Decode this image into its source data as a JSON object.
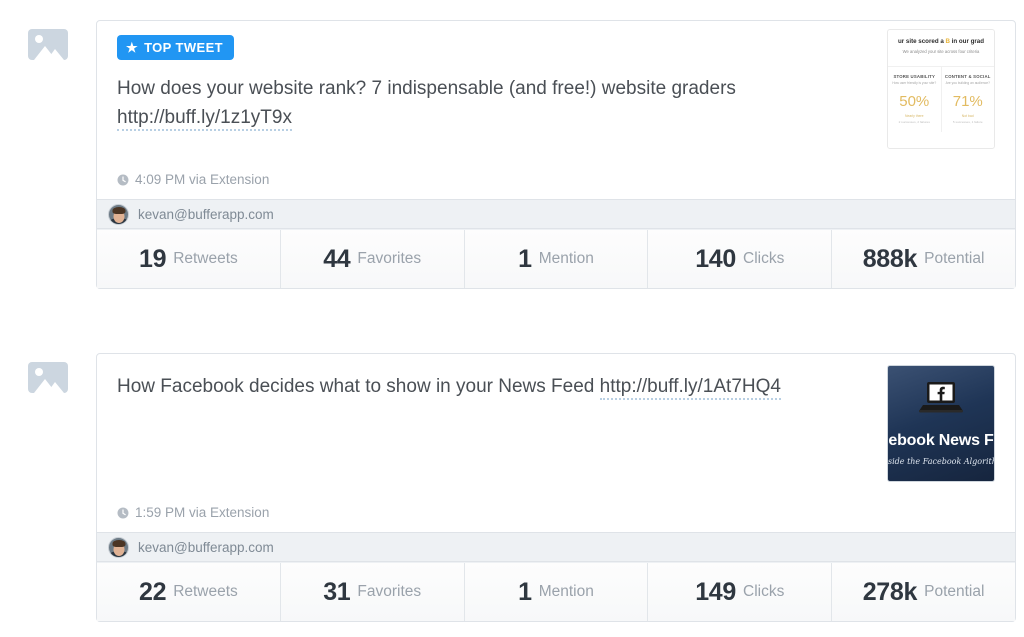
{
  "cards": [
    {
      "badge": {
        "label": "TOP TWEET",
        "icon": "star-icon",
        "color": "#2196f3"
      },
      "text": "How does your website rank? 7 indispensable (and free!) website graders ",
      "link": "http://buff.ly/1z1yT9x",
      "timestamp": "4:09 PM via Extension",
      "author_email": "kevan@bufferapp.com",
      "thumbnail": {
        "kind": "website-grader-card",
        "title_prefix": "ur site scored a ",
        "title_grade": "B",
        "title_suffix": " in our grad",
        "subtitle": "We analyzed your site across four criteria",
        "columns": [
          {
            "heading": "STORE USABILITY",
            "subheading": "How user friendly is your site?",
            "percent": "50%",
            "label": "Nearly there",
            "note": "2 successes, 2 failures"
          },
          {
            "heading": "CONTENT & SOCIAL",
            "subheading": "Are you building an audience?",
            "percent": "71%",
            "label": "Not bad",
            "note": "5 successes, 1 failure"
          }
        ]
      },
      "stats": [
        {
          "value": "19",
          "label": "Retweets"
        },
        {
          "value": "44",
          "label": "Favorites"
        },
        {
          "value": "1",
          "label": "Mention"
        },
        {
          "value": "140",
          "label": "Clicks"
        },
        {
          "value": "888k",
          "label": "Potential"
        }
      ]
    },
    {
      "badge": null,
      "text": "How Facebook decides what to show in your News Feed ",
      "link": "http://buff.ly/1At7HQ4",
      "timestamp": "1:59 PM via Extension",
      "author_email": "kevan@bufferapp.com",
      "thumbnail": {
        "kind": "facebook-news-feed-card",
        "title": "ebook News F",
        "script": "side the Facebook Algorithm",
        "icon": "laptop-facebook-icon"
      },
      "stats": [
        {
          "value": "22",
          "label": "Retweets"
        },
        {
          "value": "31",
          "label": "Favorites"
        },
        {
          "value": "1",
          "label": "Mention"
        },
        {
          "value": "149",
          "label": "Clicks"
        },
        {
          "value": "278k",
          "label": "Potential"
        }
      ]
    }
  ],
  "icons": {
    "broken_image": "image-placeholder-icon",
    "clock": "clock-icon",
    "star": "★"
  }
}
